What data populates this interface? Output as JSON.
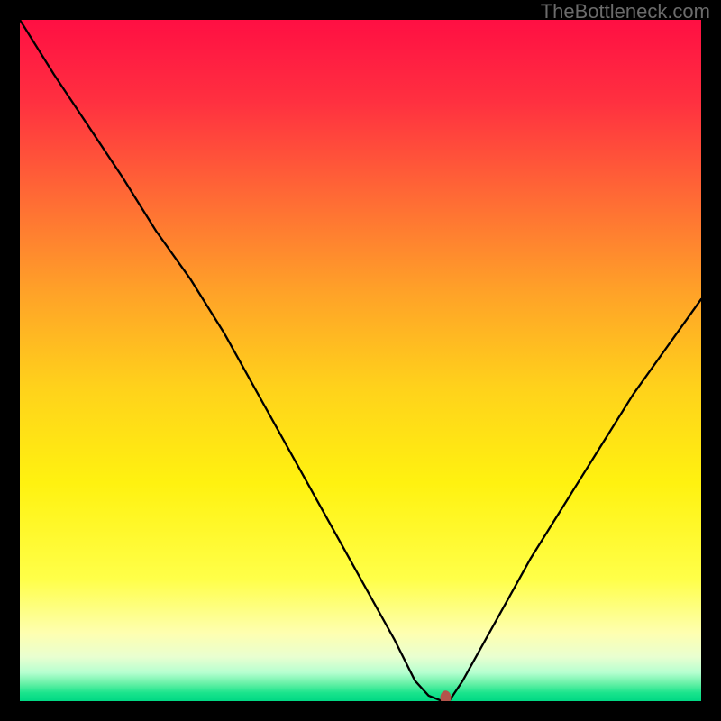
{
  "watermark": "TheBottleneck.com",
  "chart_data": {
    "type": "line",
    "title": "",
    "xlabel": "",
    "ylabel": "",
    "xlim": [
      0,
      100
    ],
    "ylim": [
      0,
      100
    ],
    "grid": false,
    "legend": false,
    "x": [
      0,
      5,
      10,
      15,
      20,
      25,
      30,
      35,
      40,
      45,
      50,
      55,
      58,
      60,
      62,
      63,
      65,
      70,
      75,
      80,
      85,
      90,
      95,
      100
    ],
    "values": [
      100,
      92,
      84.5,
      77,
      69,
      62,
      54,
      45,
      36,
      27,
      18,
      9,
      3,
      0.8,
      0,
      0,
      3,
      12,
      21,
      29,
      37,
      45,
      52,
      59
    ],
    "optimum_marker": {
      "x": 62.5,
      "y": 0.5
    }
  },
  "gradient_stops": [
    {
      "offset": 0.0,
      "color": "#ff0f43"
    },
    {
      "offset": 0.12,
      "color": "#ff3040"
    },
    {
      "offset": 0.26,
      "color": "#ff6a35"
    },
    {
      "offset": 0.4,
      "color": "#ffa228"
    },
    {
      "offset": 0.54,
      "color": "#ffd21b"
    },
    {
      "offset": 0.68,
      "color": "#fff210"
    },
    {
      "offset": 0.82,
      "color": "#ffff48"
    },
    {
      "offset": 0.9,
      "color": "#feffb0"
    },
    {
      "offset": 0.935,
      "color": "#e9ffd0"
    },
    {
      "offset": 0.958,
      "color": "#b6ffd0"
    },
    {
      "offset": 0.975,
      "color": "#62f0a5"
    },
    {
      "offset": 0.988,
      "color": "#19e48c"
    },
    {
      "offset": 1.0,
      "color": "#00d884"
    }
  ],
  "marker_color": "#b2544b",
  "curve_color": "#000000"
}
